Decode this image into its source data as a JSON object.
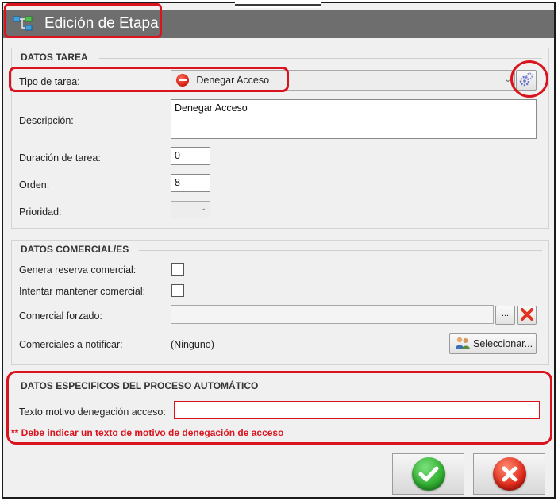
{
  "window": {
    "title": "Edición de Etapa",
    "app_icon": "workflow-icon"
  },
  "datos_tarea": {
    "section_title": "DATOS TAREA",
    "tipo_label": "Tipo de tarea:",
    "tipo_value": "Denegar Acceso",
    "tipo_icon": "deny-icon",
    "config_icon": "gears-icon",
    "descripcion_label": "Descripción:",
    "descripcion_value": "Denegar Acceso",
    "duracion_label": "Duración de tarea:",
    "duracion_value": "0",
    "orden_label": "Orden:",
    "orden_value": "8",
    "prioridad_label": "Prioridad:",
    "prioridad_value": ""
  },
  "datos_comercial": {
    "section_title": "DATOS COMERCIAL/ES",
    "genera_label": "Genera reserva comercial:",
    "genera_checked": false,
    "mantener_label": "Intentar mantener comercial:",
    "mantener_checked": false,
    "forzado_label": "Comercial forzado:",
    "forzado_value": "",
    "browse_label": "...",
    "notificar_label": "Comerciales a notificar:",
    "notificar_value": "(Ninguno)",
    "seleccionar_label": "Seleccionar..."
  },
  "datos_auto": {
    "section_title": "DATOS ESPECIFICOS DEL PROCESO AUTOMÁTICO",
    "motivo_label": "Texto motivo denegación acceso:",
    "motivo_value": "",
    "error_message": "** Debe indicar un texto de motivo de denegación de acceso"
  },
  "buttons": {
    "ok_icon": "checkmark-icon",
    "cancel_icon": "close-icon"
  },
  "colors": {
    "highlight": "#d9141e",
    "titlebar": "#6e6e6e",
    "ok": "#2fae2f",
    "cancel": "#e02a1a"
  }
}
